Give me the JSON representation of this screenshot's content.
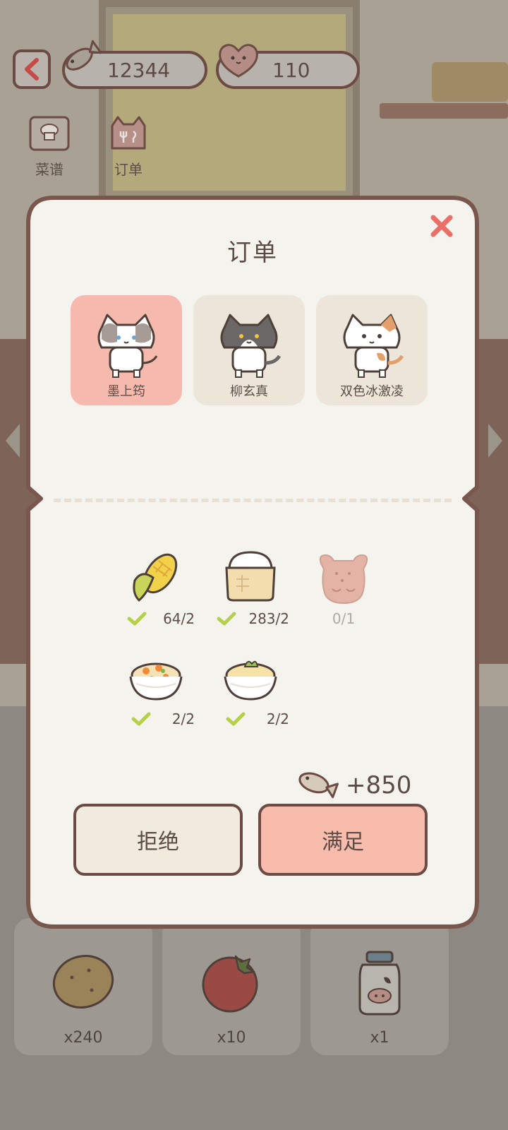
{
  "hud": {
    "fish_currency": "12344",
    "heart_currency": "110"
  },
  "menu": {
    "recipe_label": "菜谱",
    "order_label": "订单"
  },
  "dialog": {
    "title": "订单",
    "close_icon": "close-x-icon",
    "customers": [
      {
        "name": "墨上筠",
        "selected": true
      },
      {
        "name": "柳玄真",
        "selected": false
      },
      {
        "name": "双色冰激凌",
        "selected": false
      }
    ],
    "requirements": [
      {
        "item": "corn",
        "count": "64/2",
        "met": true
      },
      {
        "item": "flour-bag",
        "count": "283/2",
        "met": true
      },
      {
        "item": "bear-cookie",
        "count": "0/1",
        "met": false
      },
      {
        "item": "fried-rice-bowl",
        "count": "2/2",
        "met": true
      },
      {
        "item": "mashed-potato-bowl",
        "count": "2/2",
        "met": true
      }
    ],
    "reward": "+850",
    "reject_label": "拒绝",
    "accept_label": "满足"
  },
  "inventory": [
    {
      "item": "potato",
      "qty": "x240"
    },
    {
      "item": "tomato",
      "qty": "x10"
    },
    {
      "item": "milk-jar",
      "qty": "x1"
    }
  ],
  "colors": {
    "accent_pink": "#f8bcad",
    "border_brown": "#6b4b43",
    "check_green": "#b6cf4a",
    "close_red": "#e96f67"
  }
}
